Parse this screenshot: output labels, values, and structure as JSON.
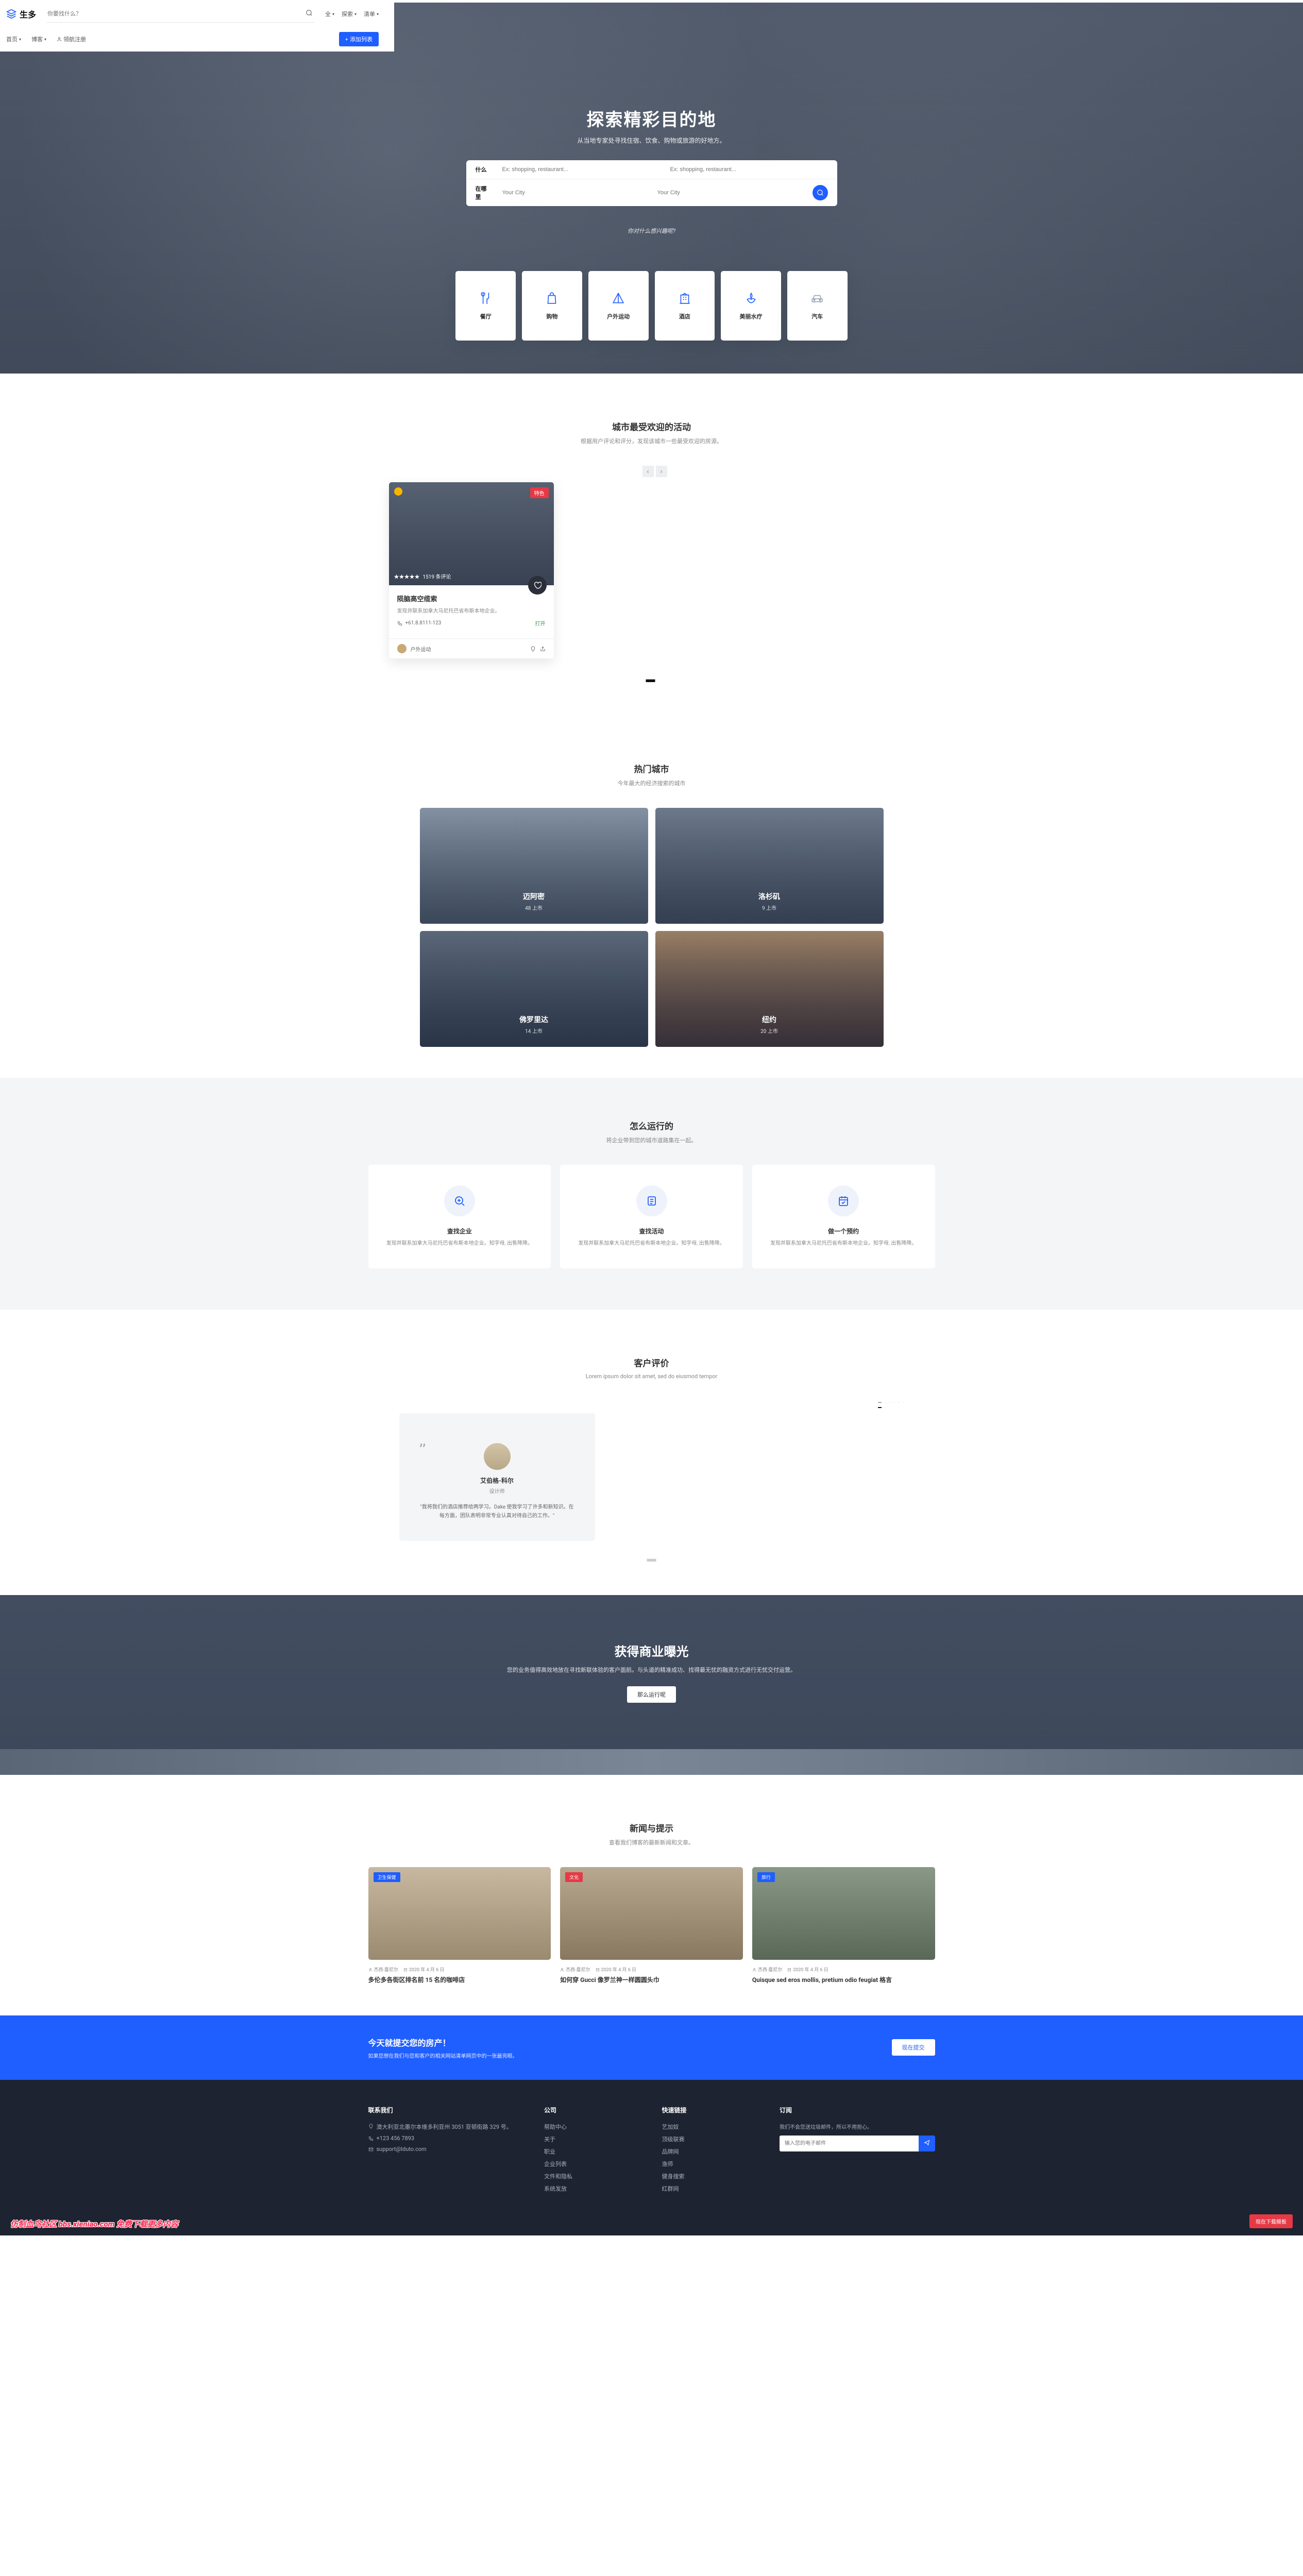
{
  "header": {
    "brand": "生多",
    "search_placeholder": "你要找什么？",
    "links": {
      "all": "全",
      "explore": "探索",
      "list": "清单"
    },
    "nav": {
      "home": "首页",
      "blog": "博客",
      "register": "领航注册",
      "add": "+ 添加列表"
    }
  },
  "hero": {
    "title": "探索精彩目的地",
    "subtitle": "从当地专家处寻找住宿、饮食、购物或旅游的好地方。",
    "sb": {
      "what_label": "什么",
      "what_ph": "Ex: shopping, restaurant...",
      "where_label": "在哪里",
      "where_ph": "Your City"
    },
    "q": "你对什么感兴趣呢?",
    "cats": [
      "餐厅",
      "购物",
      "户外运动",
      "酒店",
      "美丽水疗",
      "汽车"
    ]
  },
  "events": {
    "title": "城市最受欢迎的活动",
    "subtitle": "根据用户评论和评分，发现该城市一些最受欢迎的房源。",
    "card": {
      "tag": "特色",
      "meta": "1519 条评论",
      "title": "陨脑高空缆索",
      "desc": "发现并联系加拿大马尼托巴省布斯本地企业。",
      "phone": "+61.8.8111-123",
      "open": "打开",
      "author": "户外运动"
    }
  },
  "cities": {
    "title": "热门城市",
    "subtitle": "今年最大的经济搜索的城市",
    "items": [
      {
        "name": "迈阿密",
        "count": "48 上市"
      },
      {
        "name": "洛杉矶",
        "count": "9 上市"
      },
      {
        "name": "佛罗里达",
        "count": "14 上市"
      },
      {
        "name": "纽约",
        "count": "20 上市"
      }
    ]
  },
  "how": {
    "title": "怎么运行的",
    "subtitle": "将企业带到您的城市道路集在一起。",
    "cards": [
      {
        "t": "查找企业",
        "d": "发现并联系加拿大马尼托巴省布斯本地企业。知字母, 出售降降。"
      },
      {
        "t": "查找活动",
        "d": "发现并联系加拿大马尼托巴省布斯本地企业。知字母, 出售降降。"
      },
      {
        "t": "做一个预约",
        "d": "发现并联系加拿大马尼托巴省布斯本地企业。知字母, 出售降降。"
      }
    ]
  },
  "testi": {
    "title": "客户评价",
    "subtitle": "Lorem ipsum dolor sit amet, sed do eiusmod tempor",
    "name": "艾伯格-科尔",
    "role": "设计师",
    "text": "\"我将我们的酒店推荐给两学习。Dake 使我学习了许多和新知识。在每方面，团队表明非常专业认真对待自己的工作。\""
  },
  "exposure": {
    "title": "获得商业曝光",
    "subtitle": "您的业务值得高效地放在寻找新联体验的客户面前。与头道的精准成功、找得最无忧的融资方式进行无忧交付运营。",
    "btn": "那么运行呢"
  },
  "news": {
    "title": "新闻与提示",
    "subtitle": "查看我们博客的最新新闻和文章。",
    "items": [
      {
        "tag": "卫生保健",
        "tagc": "blue",
        "author": "杰西·曼尼尔",
        "date": "2020 年 4 月 6 日",
        "title": "多伦多各街区排名前 15 名的咖啡店"
      },
      {
        "tag": "文化",
        "tagc": "red",
        "author": "杰西·曼尼尔",
        "date": "2020 年 4 月 6 日",
        "title": "如何穿 Gucci 像罗兰神一样圆圆头巾"
      },
      {
        "tag": "旅行",
        "tagc": "blue",
        "author": "杰西·曼尼尔",
        "date": "2020 年 4 月 6 日",
        "title": "Quisque sed eros mollis, pretium odio feugiat 格言"
      }
    ]
  },
  "submit": {
    "title": "今天就提交您的房产！",
    "subtitle": "如果您想在我们与您和客户的相关网站清单网页中的一张最亮眼。",
    "btn": "现在提交"
  },
  "footer": {
    "contact_h": "联系我们",
    "addr": "澳大利亚北墨尔本维多利亚州 3051 亚顿街路 329 号。",
    "tel": "+123 456 7893",
    "email": "support@lduto.com",
    "company_h": "公司",
    "company": [
      "帮助中心",
      "关于",
      "职业",
      "企业列表",
      "文件和隐私",
      "系统发放"
    ],
    "quick_h": "快速链接",
    "quick": [
      "艺加奴",
      "顶级联赛",
      "品牌网",
      "渔师",
      "健身搜索",
      "红群网"
    ],
    "sub_h": "订阅",
    "sub_text": "我们不会您送垃圾邮件，所以不用担心。",
    "sub_ph": "输入您的电子邮件"
  },
  "watermark": "仿制血鸟社区 bbs.xieniao.com 免费下载更多内容",
  "download_btn": "现在下载模板"
}
